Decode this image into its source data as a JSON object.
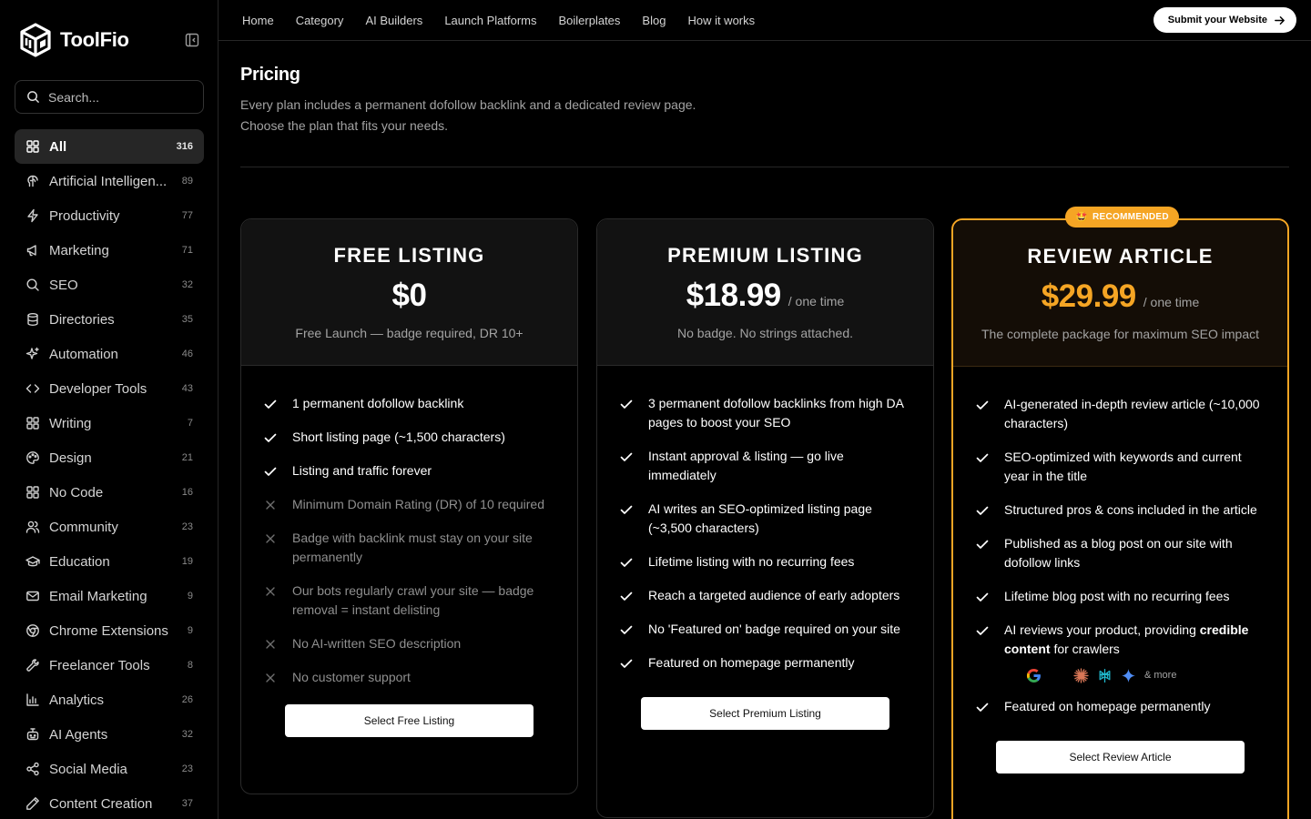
{
  "brand": {
    "name": "ToolFio"
  },
  "search": {
    "placeholder": "Search..."
  },
  "sidebar": {
    "items": [
      {
        "label": "All",
        "count": "316",
        "icon": "grid-icon",
        "active": true
      },
      {
        "label": "Artificial Intelligen...",
        "count": "89",
        "icon": "brain-icon"
      },
      {
        "label": "Productivity",
        "count": "77",
        "icon": "zap-icon"
      },
      {
        "label": "Marketing",
        "count": "71",
        "icon": "megaphone-icon"
      },
      {
        "label": "SEO",
        "count": "32",
        "icon": "search-icon"
      },
      {
        "label": "Directories",
        "count": "35",
        "icon": "database-icon"
      },
      {
        "label": "Automation",
        "count": "46",
        "icon": "sparkles-icon"
      },
      {
        "label": "Developer Tools",
        "count": "43",
        "icon": "code-icon"
      },
      {
        "label": "Writing",
        "count": "7",
        "icon": "grid-icon"
      },
      {
        "label": "Design",
        "count": "21",
        "icon": "palette-icon"
      },
      {
        "label": "No Code",
        "count": "16",
        "icon": "grid-icon"
      },
      {
        "label": "Community",
        "count": "23",
        "icon": "users-icon"
      },
      {
        "label": "Education",
        "count": "19",
        "icon": "graduation-cap-icon"
      },
      {
        "label": "Email Marketing",
        "count": "9",
        "icon": "mail-icon"
      },
      {
        "label": "Chrome Extensions",
        "count": "9",
        "icon": "chrome-icon"
      },
      {
        "label": "Freelancer Tools",
        "count": "8",
        "icon": "wrench-icon"
      },
      {
        "label": "Analytics",
        "count": "26",
        "icon": "bar-chart-icon"
      },
      {
        "label": "AI Agents",
        "count": "32",
        "icon": "bot-icon"
      },
      {
        "label": "Social Media",
        "count": "23",
        "icon": "share-icon"
      },
      {
        "label": "Content Creation",
        "count": "37",
        "icon": "pencil-icon"
      }
    ]
  },
  "topnav": {
    "links": [
      "Home",
      "Category",
      "AI Builders",
      "Launch Platforms",
      "Boilerplates",
      "Blog",
      "How it works"
    ],
    "submit_label": "Submit your Website"
  },
  "main": {
    "title": "Pricing",
    "description": "Every plan includes a permanent dofollow backlink and a dedicated review page. Choose the plan that fits your needs."
  },
  "plans": [
    {
      "title": "FREE LISTING",
      "price": "$0",
      "per": "",
      "subtitle": "Free Launch — badge required, DR 10+",
      "button": "Select Free Listing",
      "features": [
        {
          "text": "1 permanent dofollow backlink",
          "included": true
        },
        {
          "text": "Short listing page (~1,500 characters)",
          "included": true
        },
        {
          "text": "Listing and traffic forever",
          "included": true
        },
        {
          "text": "Minimum Domain Rating (DR) of 10 required",
          "included": false
        },
        {
          "text": "Badge with backlink must stay on your site permanently",
          "included": false
        },
        {
          "text": "Our bots regularly crawl your site — badge removal = instant delisting",
          "included": false
        },
        {
          "text": "No AI-written SEO description",
          "included": false
        },
        {
          "text": "No customer support",
          "included": false
        }
      ]
    },
    {
      "title": "PREMIUM LISTING",
      "price": "$18.99",
      "per": "/ one time",
      "subtitle": "No badge. No strings attached.",
      "button": "Select Premium Listing",
      "features": [
        {
          "text": "3 permanent dofollow backlinks from high DA pages to boost your SEO",
          "included": true
        },
        {
          "text": "Instant approval & listing — go live immediately",
          "included": true
        },
        {
          "text": "AI writes an SEO-optimized listing page (~3,500 characters)",
          "included": true
        },
        {
          "text": "Lifetime listing with no recurring fees",
          "included": true
        },
        {
          "text": "Reach a targeted audience of early adopters",
          "included": true
        },
        {
          "text": "No 'Featured on' badge required on your site",
          "included": true
        },
        {
          "text": "Featured on homepage permanently",
          "included": true
        }
      ]
    },
    {
      "title": "REVIEW ARTICLE",
      "price": "$29.99",
      "per": "/ one time",
      "subtitle": "The complete package for maximum SEO impact",
      "button": "Select Review Article",
      "badge": "RECOMMENDED",
      "features": [
        {
          "text": "AI-generated in-depth review article (~10,000 characters)",
          "included": true
        },
        {
          "text": "SEO-optimized with keywords and current year in the title",
          "included": true
        },
        {
          "text": "Structured pros & cons included in the article",
          "included": true
        },
        {
          "text": "Published as a blog post on our site with dofollow links",
          "included": true
        },
        {
          "text": "Lifetime blog post with no recurring fees",
          "included": true
        },
        {
          "text_before": "AI reviews your product, providing ",
          "text_bold": "credible content",
          "text_after": " for crawlers",
          "included": true
        },
        {
          "text": "Featured on homepage permanently",
          "included": true
        }
      ],
      "crawler_logos": [
        "google-icon",
        "openai-icon",
        "claude-icon",
        "perplexity-icon",
        "gemini-icon"
      ],
      "crawler_more": "& more"
    }
  ],
  "colors": {
    "accent": "#f5a524",
    "background": "#000000"
  }
}
